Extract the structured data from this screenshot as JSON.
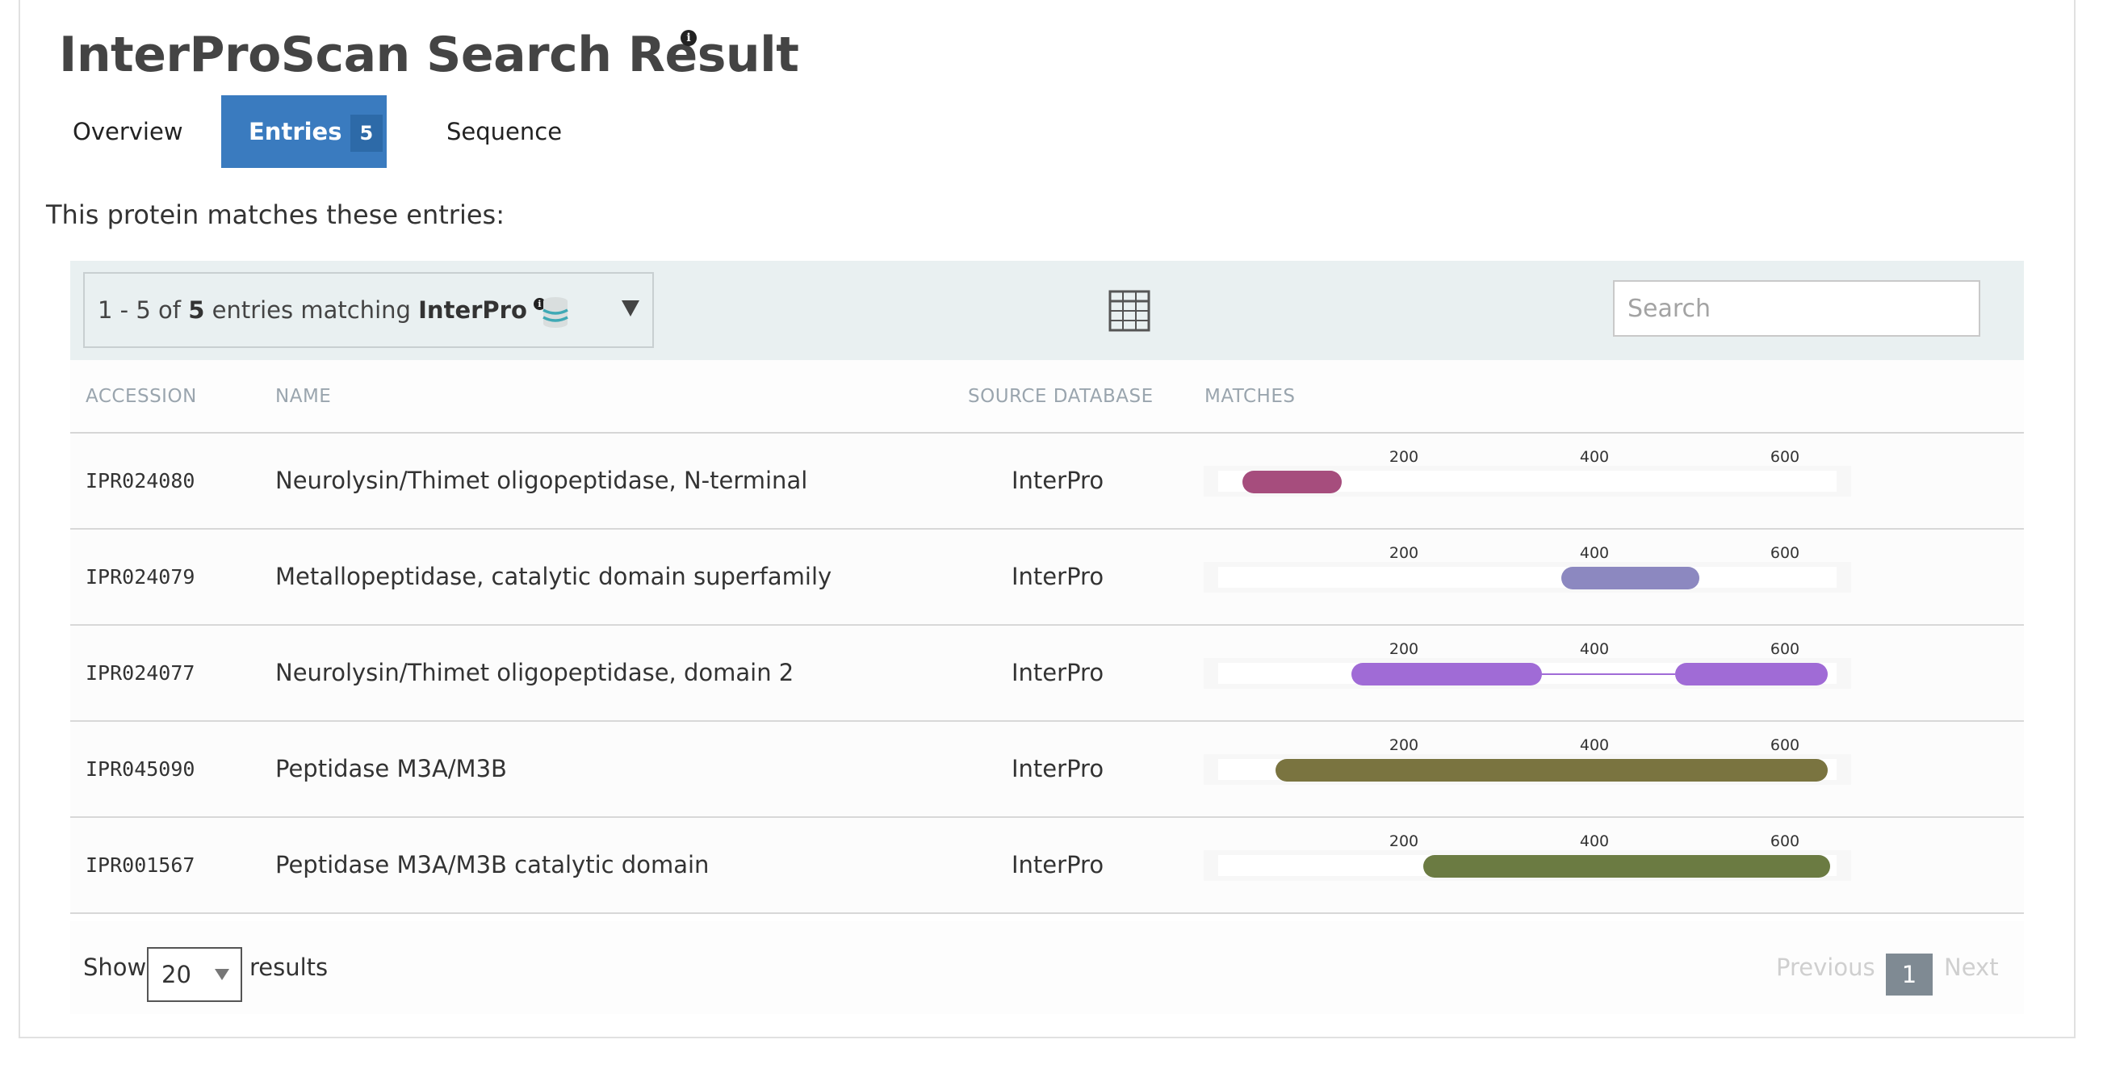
{
  "page": {
    "title": "InterProScan Search Result",
    "info_mark": "i",
    "intro": "This protein matches these entries:"
  },
  "tabs": [
    {
      "label": "Overview",
      "active": false
    },
    {
      "label": "Entries",
      "count": "5",
      "active": true
    },
    {
      "label": "Sequence",
      "active": false
    }
  ],
  "toolbar": {
    "range_text": "1 - 5 of ",
    "total": "5",
    "mid_text": " entries matching ",
    "database": "InterPro",
    "search_placeholder": "Search",
    "db_icon": "database-icon",
    "view_icon": "table-grid-icon"
  },
  "table": {
    "headers": {
      "accession": "ACCESSION",
      "name": "NAME",
      "source": "SOURCE DATABASE",
      "matches": "MATCHES"
    },
    "ticks": [
      "200",
      "400",
      "600"
    ],
    "rows": [
      {
        "accession": "IPR024080",
        "name": "Neurolysin/Thimet oligopeptidase, N-terminal",
        "source": "InterPro",
        "color": "#a64d7d",
        "segments": [
          [
            25,
            130
          ]
        ]
      },
      {
        "accession": "IPR024079",
        "name": "Metallopeptidase, catalytic domain superfamily",
        "source": "InterPro",
        "color": "#8c88c0",
        "segments": [
          [
            360,
            505
          ]
        ]
      },
      {
        "accession": "IPR024077",
        "name": "Neurolysin/Thimet oligopeptidase, domain 2",
        "source": "InterPro",
        "color": "#a06bd6",
        "segments": [
          [
            140,
            340
          ],
          [
            480,
            640
          ]
        ]
      },
      {
        "accession": "IPR045090",
        "name": "Peptidase M3A/M3B",
        "source": "InterPro",
        "color": "#7a7440",
        "segments": [
          [
            60,
            640
          ]
        ]
      },
      {
        "accession": "IPR001567",
        "name": "Peptidase M3A/M3B catalytic domain",
        "source": "InterPro",
        "color": "#6b7b42",
        "segments": [
          [
            215,
            642
          ]
        ]
      }
    ]
  },
  "footer": {
    "show_label": "Show",
    "page_size": "20",
    "results_label": "results",
    "previous": "Previous",
    "current_page": "1",
    "next": "Next"
  },
  "colors": {
    "tab_active": "#3a7bbf",
    "toolbar_bg": "#e9f0f1"
  }
}
